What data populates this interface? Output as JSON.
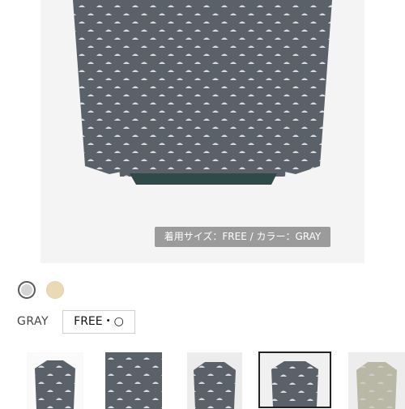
{
  "product_image": {
    "caption": "着用サイズ：FREE / カラー：GRAY"
  },
  "color_options": [
    {
      "name": "gray",
      "hex": "#d5d5d5",
      "selected": true
    },
    {
      "name": "beige",
      "hex": "#ead9b2",
      "selected": false
    }
  ],
  "selected_color_label": "GRAY",
  "size_option": "FREE・○",
  "thumbnails": [
    {
      "name": "front-view"
    },
    {
      "name": "fabric-closeup"
    },
    {
      "name": "model-front"
    },
    {
      "name": "model-front-selected",
      "selected": true
    },
    {
      "name": "beige-variant"
    }
  ],
  "colors": {
    "garment": "#5b6168",
    "hem": "#2f4a48",
    "dots": "#d9dbe0",
    "background": "#f4f4f4"
  }
}
